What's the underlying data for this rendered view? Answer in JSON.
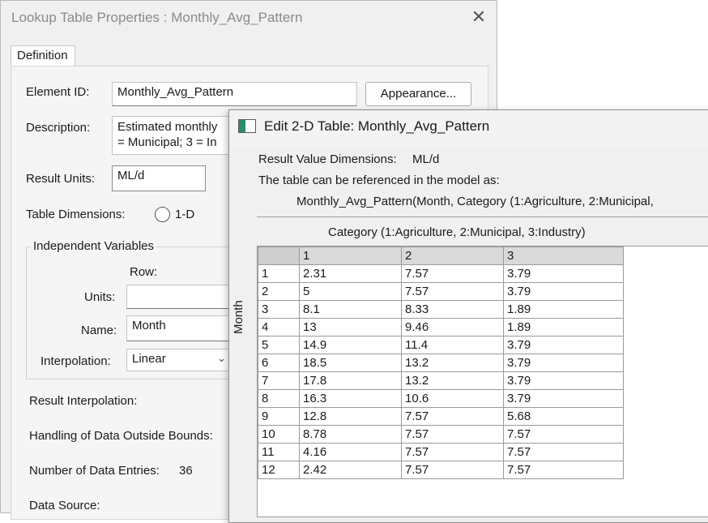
{
  "lookup_dialog": {
    "title": "Lookup Table Properties : Monthly_Avg_Pattern",
    "close_glyph": "✕",
    "tab_label": "Definition",
    "element_id_label": "Element ID:",
    "element_id_value": "Monthly_Avg_Pattern",
    "appearance_button": "Appearance...",
    "description_label": "Description:",
    "description_line1": "Estimated monthly",
    "description_line2": "= Municipal; 3 = In",
    "result_units_label": "Result Units:",
    "result_units_value": "ML/d",
    "table_dimensions_label": "Table Dimensions:",
    "table_dimensions_option": "1-D",
    "independent_variables_title": "Independent Variables",
    "row_label": "Row:",
    "units_label": "Units:",
    "units_value": "",
    "name_label": "Name:",
    "name_value": "Month",
    "interpolation_label": "Interpolation:",
    "interpolation_value": "Linear",
    "result_interpolation_label": "Result Interpolation:",
    "outside_bounds_label": "Handling of Data Outside Bounds:",
    "data_entries_label": "Number of Data Entries:",
    "data_entries_value": "36",
    "data_source_label": "Data Source:"
  },
  "edit_dialog": {
    "title": "Edit 2-D Table: Monthly_Avg_Pattern",
    "result_dims_label": "Result Value Dimensions:",
    "result_dims_value": "ML/d",
    "reference_label": "The table can be referenced in the model as:",
    "reference_expression": "Monthly_Avg_Pattern(Month, Category (1:Agriculture, 2:Municipal,",
    "column_axis_label": "Category (1:Agriculture, 2:Municipal, 3:Industry)",
    "row_axis_label": "Month",
    "table": {
      "columns": [
        "1",
        "2",
        "3"
      ],
      "rows": [
        {
          "label": "1",
          "values": [
            "2.31",
            "7.57",
            "3.79"
          ]
        },
        {
          "label": "2",
          "values": [
            "5",
            "7.57",
            "3.79"
          ]
        },
        {
          "label": "3",
          "values": [
            "8.1",
            "8.33",
            "1.89"
          ]
        },
        {
          "label": "4",
          "values": [
            "13",
            "9.46",
            "1.89"
          ]
        },
        {
          "label": "5",
          "values": [
            "14.9",
            "11.4",
            "3.79"
          ]
        },
        {
          "label": "6",
          "values": [
            "18.5",
            "13.2",
            "3.79"
          ]
        },
        {
          "label": "7",
          "values": [
            "17.8",
            "13.2",
            "3.79"
          ]
        },
        {
          "label": "8",
          "values": [
            "16.3",
            "10.6",
            "3.79"
          ]
        },
        {
          "label": "9",
          "values": [
            "12.8",
            "7.57",
            "5.68"
          ]
        },
        {
          "label": "10",
          "values": [
            "8.78",
            "7.57",
            "7.57"
          ]
        },
        {
          "label": "11",
          "values": [
            "4.16",
            "7.57",
            "7.57"
          ]
        },
        {
          "label": "12",
          "values": [
            "2.42",
            "7.57",
            "7.57"
          ]
        }
      ]
    }
  }
}
